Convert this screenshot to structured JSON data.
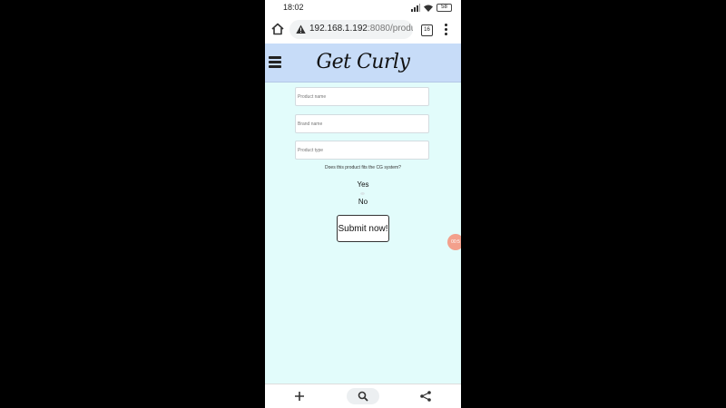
{
  "status_bar": {
    "time": "18:02",
    "battery": "58"
  },
  "browser": {
    "url_host": "192.168.1.192",
    "url_rest": ":8080/produc",
    "tab_count": "16"
  },
  "site": {
    "title": "Get Curly"
  },
  "form": {
    "product_name_placeholder": "Product name",
    "brand_name_placeholder": "Brand name",
    "product_type_placeholder": "Product type",
    "question": "Does this product fits the CG system?",
    "option_yes": "Yes",
    "option_no": "No",
    "submit_label": "Submit now!"
  },
  "floating_badge": {
    "label": "00:5"
  },
  "icons": {
    "home": "home-icon",
    "warning": "warning-icon",
    "tabs": "tabs-icon",
    "menu": "more-vert-icon",
    "hamburger": "hamburger-menu-icon",
    "new_tab": "plus-icon",
    "search": "search-icon",
    "share": "share-icon"
  }
}
